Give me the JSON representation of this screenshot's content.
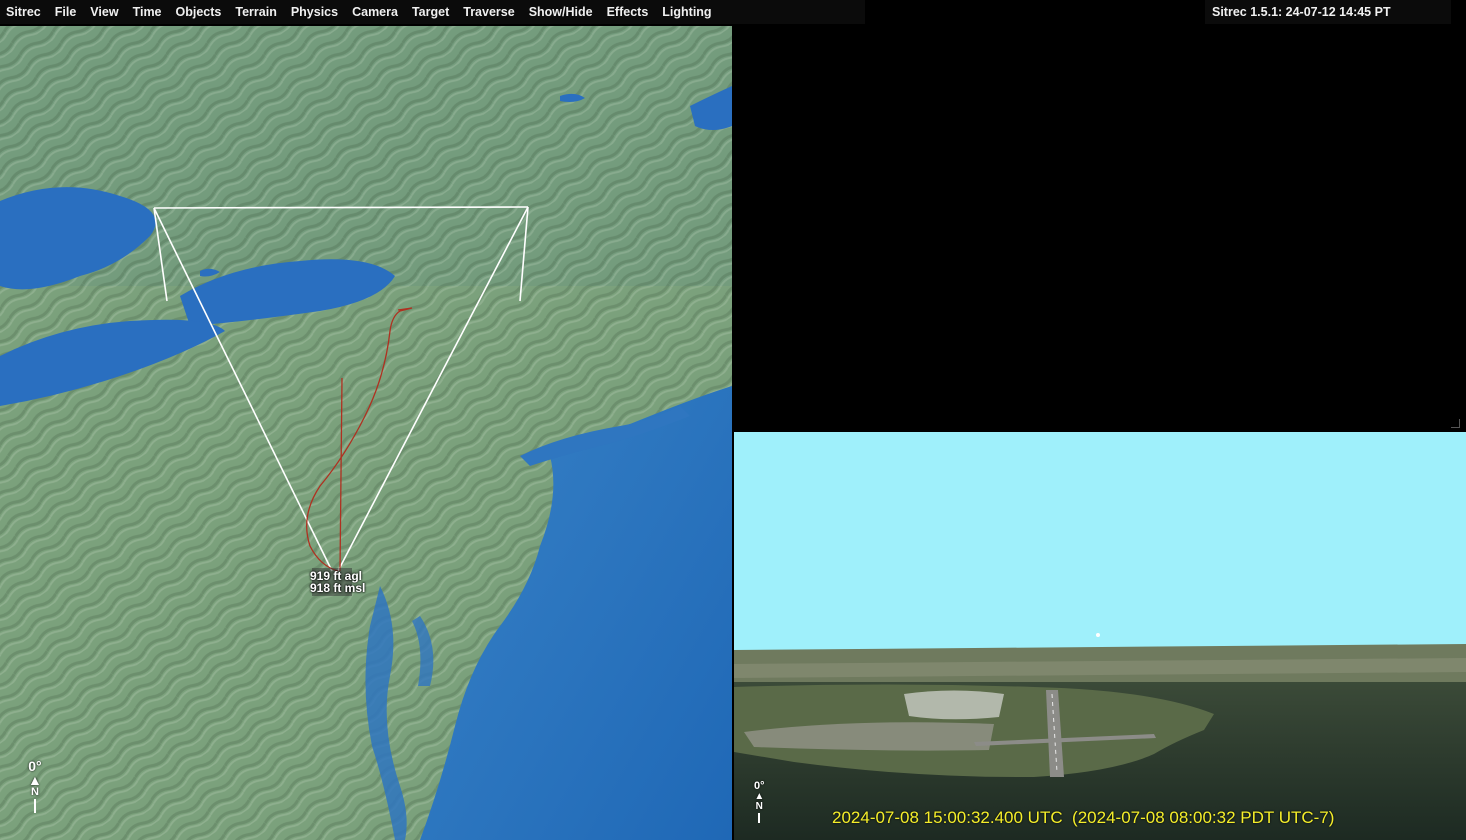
{
  "menu": {
    "items": [
      "Sitrec",
      "File",
      "View",
      "Time",
      "Objects",
      "Terrain",
      "Physics",
      "Camera",
      "Target",
      "Traverse",
      "Show/Hide",
      "Effects",
      "Lighting"
    ],
    "version": "Sitrec 1.5.1: 24-07-12 14:45 PT"
  },
  "main_view": {
    "readout_agl": "919 ft agl",
    "readout_msl": "918 ft msl",
    "compass_heading": "0°",
    "compass_north": "N"
  },
  "camera_view": {
    "compass_heading": "0°",
    "compass_north": "N",
    "timestamp": "2024-07-08 15:00:32.400 UTC  (2024-07-08 08:00:32 PDT UTC-7)"
  },
  "colors": {
    "sky": "#9ff0fb",
    "timestamp_text": "#f5ee2a",
    "water": "#2a6fc0",
    "land": "#7b9f78",
    "track": "#b03020"
  }
}
